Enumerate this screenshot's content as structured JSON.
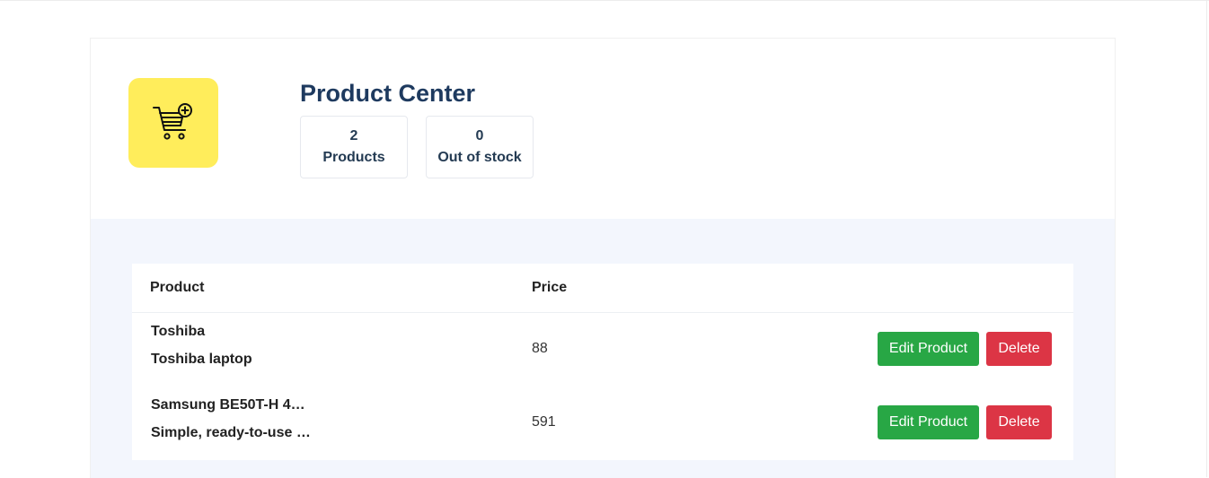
{
  "header": {
    "logo_icon": "cart-add-icon",
    "title": "Product Center",
    "stats": [
      {
        "value": "2",
        "label": "Products"
      },
      {
        "value": "0",
        "label": "Out of stock"
      }
    ]
  },
  "table": {
    "columns": [
      "Product",
      "Price"
    ],
    "rows": [
      {
        "name": "Toshiba",
        "description": "Toshiba laptop",
        "price": "88",
        "edit_label": "Edit Product",
        "delete_label": "Delete"
      },
      {
        "name": "Samsung BE50T-H 4…",
        "description": "Simple, ready-to-use …",
        "price": "591",
        "edit_label": "Edit Product",
        "delete_label": "Delete"
      }
    ]
  },
  "colors": {
    "logo_bg": "#ffed5b",
    "title": "#1e3a5f",
    "content_bg": "#f3f6fd",
    "edit_button": "#28a745",
    "delete_button": "#dc3545"
  }
}
